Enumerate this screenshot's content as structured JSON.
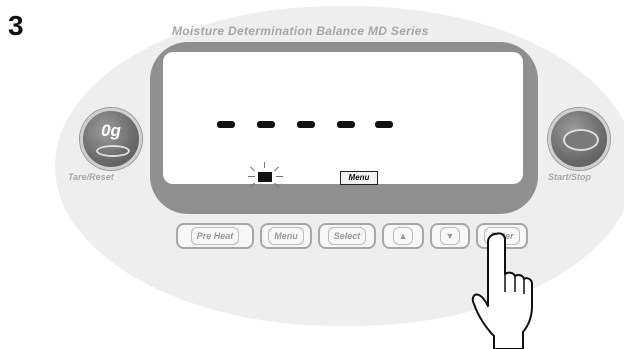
{
  "step_number": "3",
  "panel_title": "Moisture Determination Balance  MD Series",
  "display": {
    "dash_count": 5,
    "menu_indicator": "Menu"
  },
  "side_buttons": {
    "tare_label": "0g",
    "tare_caption": "Tare/Reset",
    "start_caption": "Start/Stop"
  },
  "keys": {
    "pre_heat": "Pre Heat",
    "menu": "Menu",
    "select": "Select",
    "up": "▲",
    "down": "▼",
    "enter": "Enter"
  },
  "colors": {
    "frame": "#8f8f8f",
    "shell": "#eeeeee",
    "caption": "#a8a8a8"
  }
}
